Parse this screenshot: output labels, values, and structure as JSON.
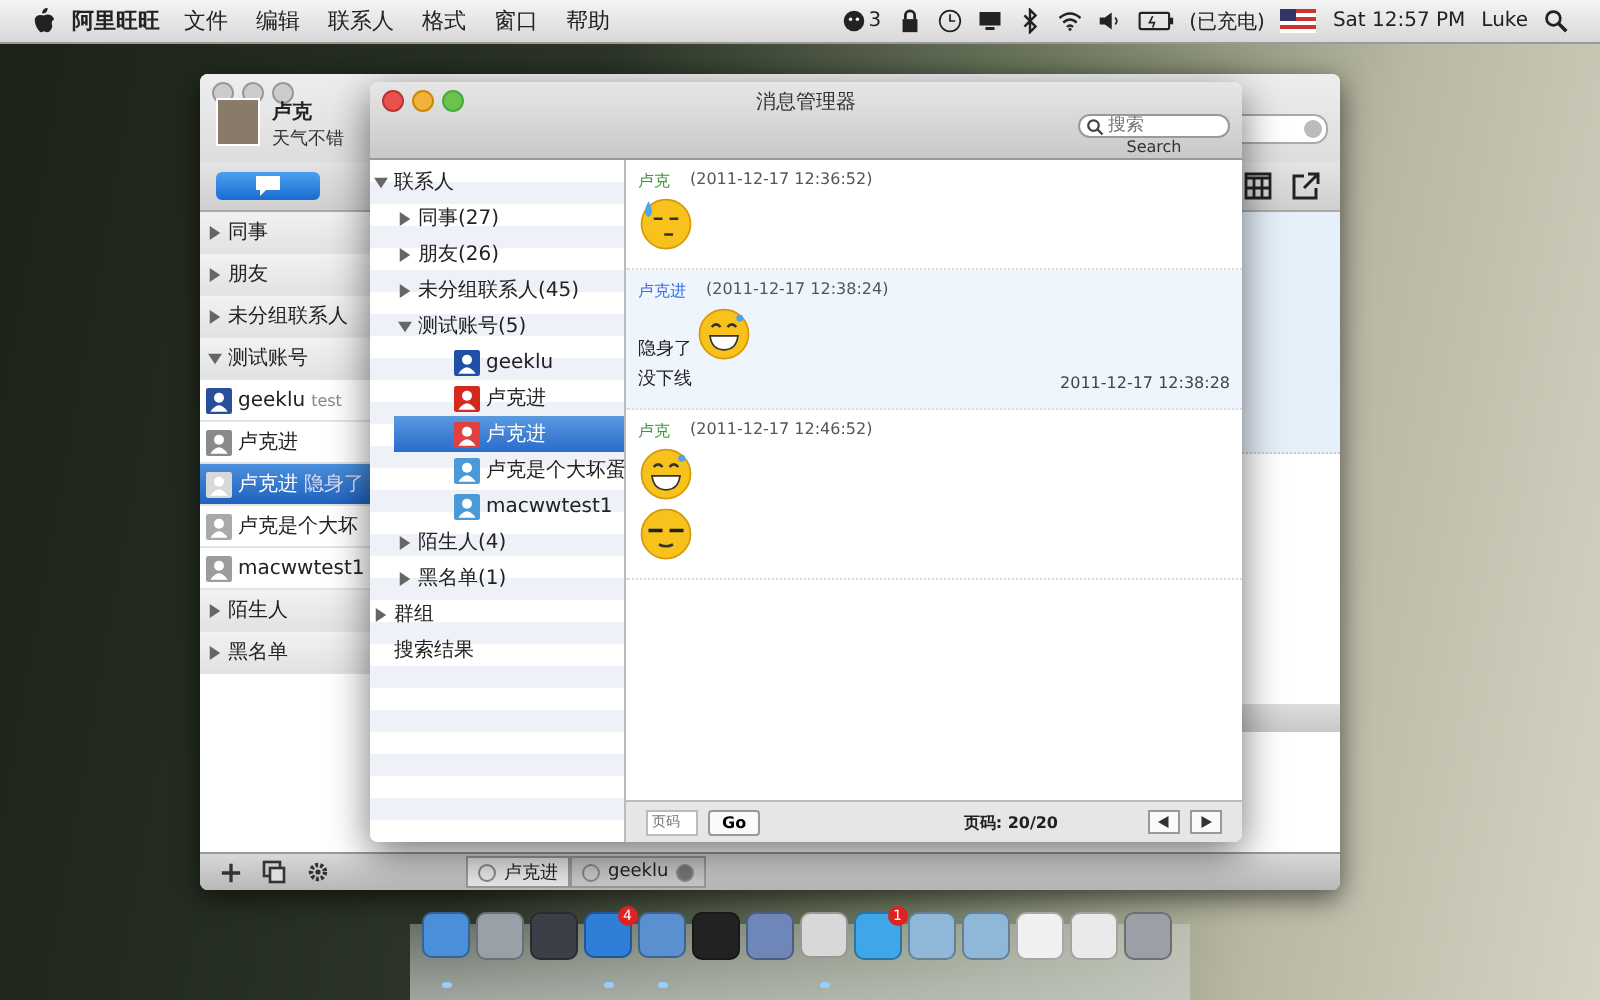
{
  "menu_bar": {
    "app_name": "阿里旺旺",
    "menus": [
      "文件",
      "编辑",
      "联系人",
      "格式",
      "窗口",
      "帮助"
    ],
    "notification_count": "3",
    "battery_status": "(已充电)",
    "clock": "Sat 12:57 PM",
    "user": "Luke"
  },
  "main_window": {
    "profile": {
      "name": "卢克",
      "status": "天气不错"
    },
    "contacts": [
      {
        "kind": "group",
        "label": "同事",
        "expanded": false
      },
      {
        "kind": "group",
        "label": "朋友",
        "expanded": false
      },
      {
        "kind": "group",
        "label": "未分组联系人",
        "expanded": false
      },
      {
        "kind": "group",
        "label": "测试账号",
        "expanded": true
      },
      {
        "kind": "contact",
        "label": "geeklu",
        "note": "test",
        "selected": false,
        "color": "#2a4f9a"
      },
      {
        "kind": "contact",
        "label": "卢克进",
        "selected": false,
        "color": "#8a8a8a"
      },
      {
        "kind": "contact",
        "label": "卢克进",
        "note": "隐身了",
        "selected": true,
        "color": "#d8d8d8"
      },
      {
        "kind": "contact",
        "label": "卢克是个大坏",
        "selected": false,
        "color": "#a9a9a9"
      },
      {
        "kind": "contact",
        "label": "macwwtest1",
        "selected": false,
        "color": "#9c9c9c"
      },
      {
        "kind": "group",
        "label": "陌生人",
        "expanded": false
      },
      {
        "kind": "group",
        "label": "黑名单",
        "expanded": false
      }
    ],
    "tabs": [
      {
        "label": "卢克进",
        "selected": true
      },
      {
        "label": "geeklu",
        "selected": false
      }
    ]
  },
  "message_manager": {
    "title": "消息管理器",
    "search": {
      "placeholder": "搜索",
      "label": "Search"
    },
    "tree": [
      {
        "label": "联系人",
        "expanded": true,
        "children": [
          {
            "label": "同事(27)",
            "expanded": false
          },
          {
            "label": "朋友(26)",
            "expanded": false
          },
          {
            "label": "未分组联系人(45)",
            "expanded": false
          },
          {
            "label": "测试账号(5)",
            "expanded": true,
            "children": [
              {
                "label": "geeklu",
                "selected": false,
                "color": "#1f4fa8"
              },
              {
                "label": "卢克进",
                "selected": false,
                "color": "#d42a1e"
              },
              {
                "label": "卢克进",
                "selected": true,
                "color": "#e04040"
              },
              {
                "label": "卢克是个大坏蛋",
                "selected": false,
                "color": "#4a9ad8"
              },
              {
                "label": "macwwtest1",
                "selected": false,
                "color": "#4a9ad8"
              }
            ]
          },
          {
            "label": "陌生人(4)",
            "expanded": false
          },
          {
            "label": "黑名单(1)",
            "expanded": false
          }
        ]
      },
      {
        "label": "群组",
        "expanded": false
      },
      {
        "label": "搜索结果"
      }
    ],
    "messages": [
      {
        "kind": "received",
        "sender": "卢克",
        "time": "(2011-12-17 12:36:52)",
        "lines": [
          {
            "parts": [
              {
                "kind": "sweat"
              }
            ]
          }
        ]
      },
      {
        "kind": "sent",
        "sender": "卢克进",
        "time": "(2011-12-17 12:38:24)",
        "lines": [
          {
            "parts": [
              {
                "kind": "text",
                "text": "隐身了"
              },
              {
                "kind": "grin"
              }
            ]
          },
          {
            "parts": [
              {
                "kind": "text",
                "text": "没下线"
              }
            ],
            "stamp": "2011-12-17 12:38:28"
          }
        ]
      },
      {
        "kind": "received",
        "sender": "卢克",
        "time": "(2011-12-17 12:46:52)",
        "lines": [
          {
            "parts": [
              {
                "kind": "grin"
              }
            ]
          },
          {
            "parts": [
              {
                "kind": "squint"
              }
            ]
          }
        ]
      }
    ],
    "pager": {
      "page_placeholder": "页码",
      "go": "Go",
      "page": "页码: 20/20"
    }
  },
  "dock": [
    {
      "running": true
    },
    {
      "running": false
    },
    {
      "running": false
    },
    {
      "running": true,
      "badge": "4"
    },
    {
      "running": true
    },
    {
      "running": false
    },
    {
      "running": false
    },
    {
      "running": true
    },
    {
      "running": false,
      "badge": "1"
    },
    {
      "running": false
    },
    {
      "running": false
    },
    {
      "running": false
    },
    {
      "running": false
    },
    {
      "running": false
    }
  ]
}
